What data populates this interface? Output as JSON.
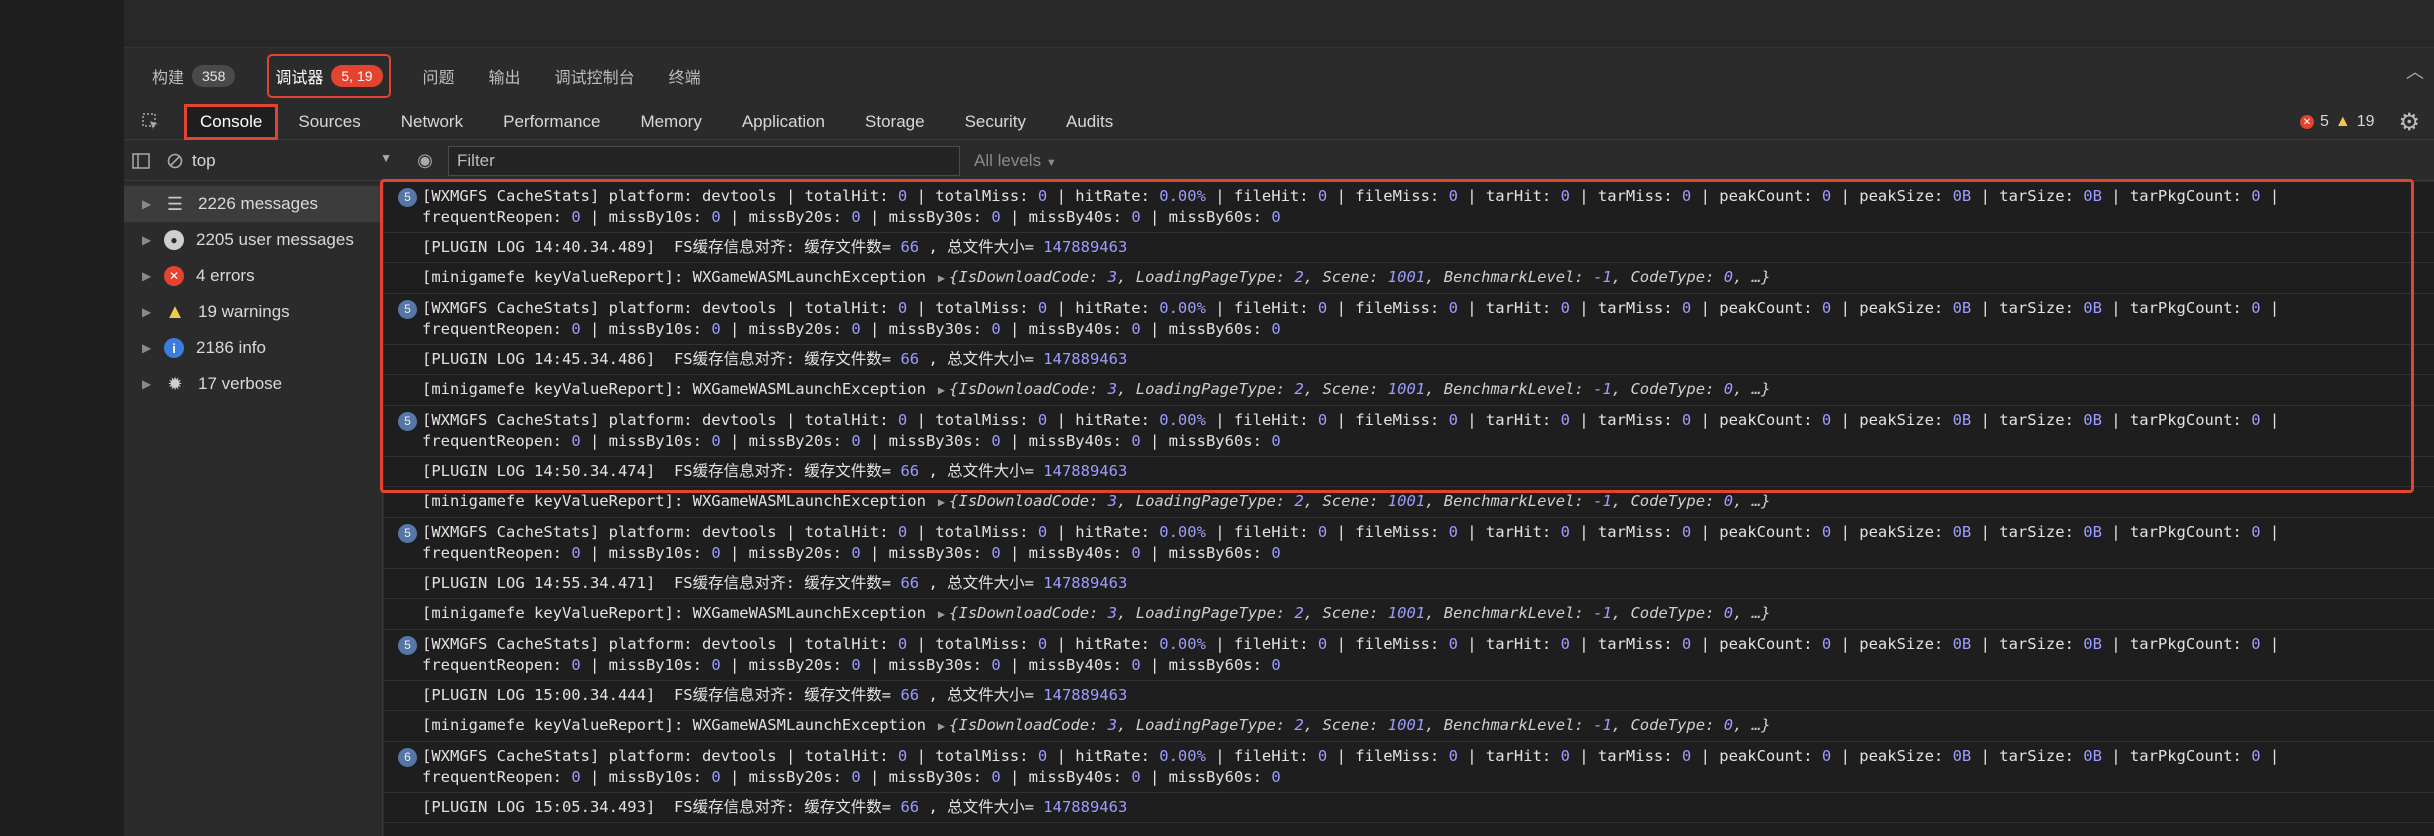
{
  "panel_tabs": [
    {
      "label": "构建",
      "badge": "358"
    },
    {
      "label": "调试器",
      "badge": "5, 19",
      "active": true
    },
    {
      "label": "问题"
    },
    {
      "label": "输出"
    },
    {
      "label": "调试控制台"
    },
    {
      "label": "终端"
    }
  ],
  "devtools_tabs": [
    {
      "label": "Console",
      "active": true
    },
    {
      "label": "Sources"
    },
    {
      "label": "Network"
    },
    {
      "label": "Performance"
    },
    {
      "label": "Memory"
    },
    {
      "label": "Application"
    },
    {
      "label": "Storage"
    },
    {
      "label": "Security"
    },
    {
      "label": "Audits"
    }
  ],
  "status": {
    "errors": "5",
    "warnings": "19"
  },
  "toolbar": {
    "context": "top",
    "filter_placeholder": "Filter",
    "levels": "All levels"
  },
  "sidebar": {
    "items": [
      {
        "label": "2226 messages",
        "icon": "list-icon"
      },
      {
        "label": "2205 user messages",
        "icon": "user-icon"
      },
      {
        "label": "4 errors",
        "icon": "error-icon"
      },
      {
        "label": "19 warnings",
        "icon": "warning-icon"
      },
      {
        "label": "2186 info",
        "icon": "info-icon"
      },
      {
        "label": "17 verbose",
        "icon": "bug-icon"
      }
    ]
  },
  "console": {
    "stats_line1": "[WXMGFS CacheStats] platform: devtools | totalHit: 0 | totalMiss: 0 | hitRate: 0.00% | fileHit: 0 | fileMiss: 0 | tarHit: 0 | tarMiss: 0 | peakCount: 0 | peakSize: 0B | tarSize: 0B | tarPkgCount: 0 |",
    "stats_line2": "frequentReopen: 0 | missBy10s: 0 | missBy20s: 0 | missBy30s: 0 | missBy40s: 0 | missBy60s: 0",
    "report_prefix": "[minigamefe keyValueReport]: WXGameWASMLaunchException",
    "report_obj": "{IsDownloadCode: 3, LoadingPageType: 2, Scene: 1001, BenchmarkLevel: -1, CodeType: 0, …}",
    "plugin_text": "FS缓存信息对齐: 缓存文件数= 66 , 总文件大小= 147889463",
    "messages": [
      {
        "type": "stats",
        "count": "5"
      },
      {
        "type": "plugin",
        "time": "[PLUGIN LOG 14:40.34.489]"
      },
      {
        "type": "report"
      },
      {
        "type": "stats",
        "count": "5"
      },
      {
        "type": "plugin",
        "time": "[PLUGIN LOG 14:45.34.486]"
      },
      {
        "type": "report"
      },
      {
        "type": "stats",
        "count": "5"
      },
      {
        "type": "plugin",
        "time": "[PLUGIN LOG 14:50.34.474]"
      },
      {
        "type": "report"
      },
      {
        "type": "stats",
        "count": "5"
      },
      {
        "type": "plugin",
        "time": "[PLUGIN LOG 14:55.34.471]"
      },
      {
        "type": "report"
      },
      {
        "type": "stats",
        "count": "5"
      },
      {
        "type": "plugin",
        "time": "[PLUGIN LOG 15:00.34.444]"
      },
      {
        "type": "report"
      },
      {
        "type": "stats",
        "count": "6"
      },
      {
        "type": "plugin",
        "time": "[PLUGIN LOG 15:05.34.493]"
      }
    ]
  },
  "colors": {
    "accent_red": "#e3432f",
    "number_purple": "#9d9cff"
  }
}
